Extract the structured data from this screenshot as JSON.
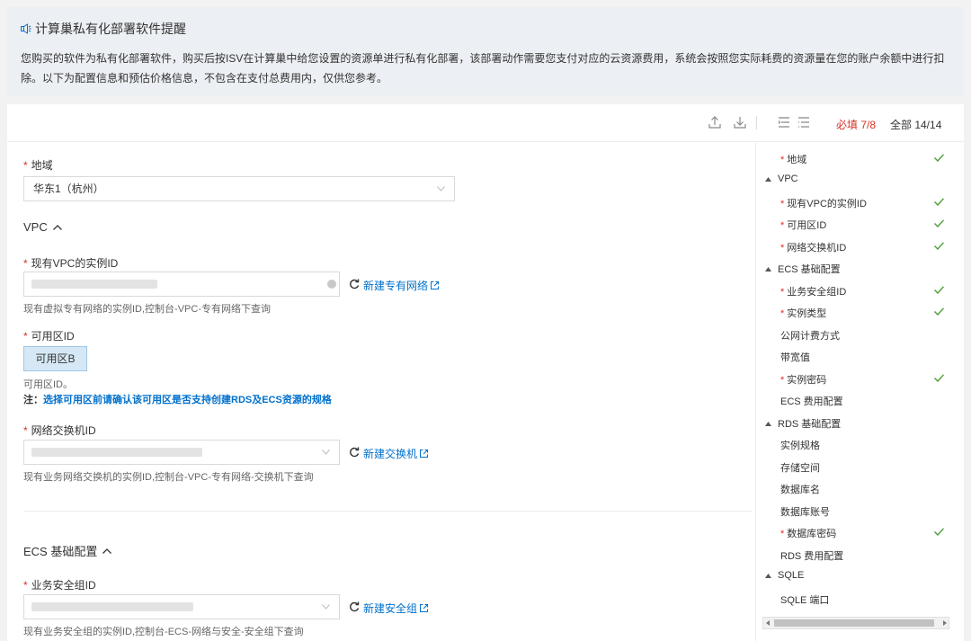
{
  "notice": {
    "title": "计算巢私有化部署软件提醒",
    "body": "您购买的软件为私有化部署软件，购买后按ISV在计算巢中给您设置的资源单进行私有化部署，该部署动作需要您支付对应的云资源费用，系统会按照您实际耗费的资源量在您的账户余额中进行扣除。以下为配置信息和预估价格信息，不包含在支付总费用内，仅供您参考。"
  },
  "toolbar": {
    "required_label": "必填 7/8",
    "all_label": "全部 14/14"
  },
  "form": {
    "region": {
      "label": "地域",
      "value": "华东1（杭州）"
    },
    "vpc_section": "VPC",
    "vpc_id": {
      "label": "现有VPC的实例ID",
      "link": "新建专有网络",
      "help": "现有虚拟专有网络的实例ID,控制台-VPC-专有网络下查询"
    },
    "zone": {
      "label": "可用区ID",
      "value": "可用区B",
      "help": "可用区ID。",
      "note_prefix": "注：",
      "note_link": "选择可用区前请确认该可用区是否支持创建RDS及ECS资源的规格"
    },
    "vswitch": {
      "label": "网络交换机ID",
      "link": "新建交换机",
      "help": "现有业务网络交换机的实例ID,控制台-VPC-专有网络-交换机下查询"
    },
    "ecs_section": "ECS 基础配置",
    "security_group": {
      "label": "业务安全组ID",
      "link": "新建安全组",
      "help": "现有业务安全组的实例ID,控制台-ECS-网络与安全-安全组下查询"
    }
  },
  "nav": {
    "items": [
      {
        "label": "地域",
        "required": true,
        "done": true
      },
      {
        "label": "VPC",
        "group": true
      },
      {
        "label": "现有VPC的实例ID",
        "required": true,
        "done": true
      },
      {
        "label": "可用区ID",
        "required": true,
        "done": true
      },
      {
        "label": "网络交换机ID",
        "required": true,
        "done": true
      },
      {
        "label": "ECS 基础配置",
        "group": true
      },
      {
        "label": "业务安全组ID",
        "required": true,
        "done": true
      },
      {
        "label": "实例类型",
        "required": true,
        "done": true
      },
      {
        "label": "公网计费方式"
      },
      {
        "label": "带宽值"
      },
      {
        "label": "实例密码",
        "required": true,
        "done": true
      },
      {
        "label": "ECS 费用配置"
      },
      {
        "label": "RDS 基础配置",
        "group": true
      },
      {
        "label": "实例规格"
      },
      {
        "label": "存储空间"
      },
      {
        "label": "数据库名"
      },
      {
        "label": "数据库账号"
      },
      {
        "label": "数据库密码",
        "required": true,
        "done": true
      },
      {
        "label": "RDS 费用配置"
      },
      {
        "label": "SQLE",
        "group": true
      },
      {
        "label": "SQLE 端口"
      }
    ]
  },
  "colors": {
    "accent": "#0070cc",
    "required": "#d93026",
    "check": "#4a9d38"
  }
}
